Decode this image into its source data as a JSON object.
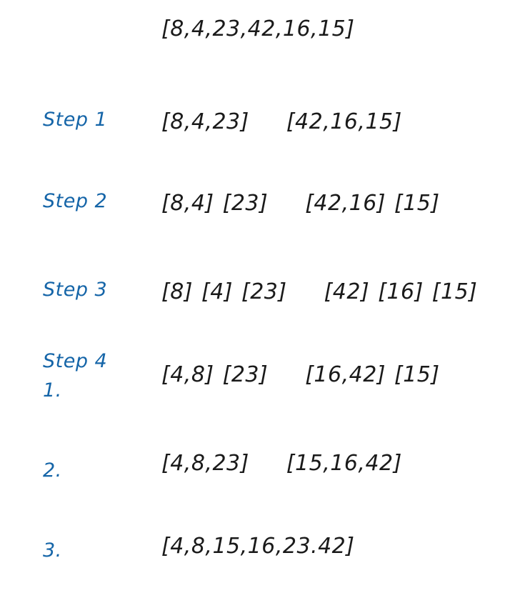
{
  "colors": {
    "label": "#1565a8",
    "text": "#1a1a1a",
    "background": "#ffffff"
  },
  "header": {
    "array": "[8,4,23,42,16,15]"
  },
  "rows": [
    {
      "label": "Step 1",
      "sublabel": "",
      "groups": [
        [
          "[8,4,23]"
        ],
        [
          "[42,16,15]"
        ]
      ]
    },
    {
      "label": "Step 2",
      "sublabel": "",
      "groups": [
        [
          "[8,4]",
          "[23]"
        ],
        [
          "[42,16]",
          "[15]"
        ]
      ]
    },
    {
      "label": "Step 3",
      "sublabel": "",
      "groups": [
        [
          "[8]",
          "[4]",
          "[23]"
        ],
        [
          "[42]",
          "[16]",
          "[15]"
        ]
      ]
    },
    {
      "label": "Step 4",
      "sublabel": "1.",
      "groups": [
        [
          "[4,8]",
          "[23]"
        ],
        [
          "[16,42]",
          "[15]"
        ]
      ]
    },
    {
      "label": "2.",
      "sublabel": "",
      "groups": [
        [
          "[4,8,23]"
        ],
        [
          "[15,16,42]"
        ]
      ]
    },
    {
      "label": "3.",
      "sublabel": "",
      "groups": [
        [
          "[4,8,15,16,23.42]"
        ]
      ]
    }
  ]
}
